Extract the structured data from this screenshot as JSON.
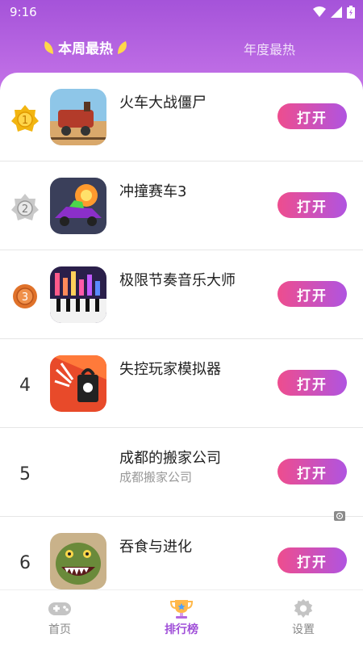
{
  "status": {
    "time": "9:16"
  },
  "tabs": {
    "active": "本周最热",
    "inactive": "年度最热"
  },
  "list": [
    {
      "rank": "1",
      "medal": "gold",
      "name": "火车大战僵尸",
      "sub": "",
      "button": "打开"
    },
    {
      "rank": "2",
      "medal": "silver",
      "name": "冲撞赛车3",
      "sub": "",
      "button": "打开"
    },
    {
      "rank": "3",
      "medal": "bronze",
      "name": "极限节奏音乐大师",
      "sub": "",
      "button": "打开"
    },
    {
      "rank": "4",
      "medal": "",
      "name": "失控玩家模拟器",
      "sub": "",
      "button": "打开"
    },
    {
      "rank": "5",
      "medal": "",
      "name": "成都的搬家公司",
      "sub": "成都搬家公司",
      "button": "打开"
    },
    {
      "rank": "6",
      "medal": "",
      "name": "吞食与进化",
      "sub": "",
      "button": "打开"
    }
  ],
  "nav": {
    "home": "首页",
    "rank": "排行榜",
    "settings": "设置"
  },
  "colors": {
    "accent": "#a553d9",
    "button_start": "#ee4d8e",
    "button_end": "#b054e0",
    "gold": "#f2b511",
    "silver": "#b9b9b9",
    "bronze": "#e0722a"
  }
}
